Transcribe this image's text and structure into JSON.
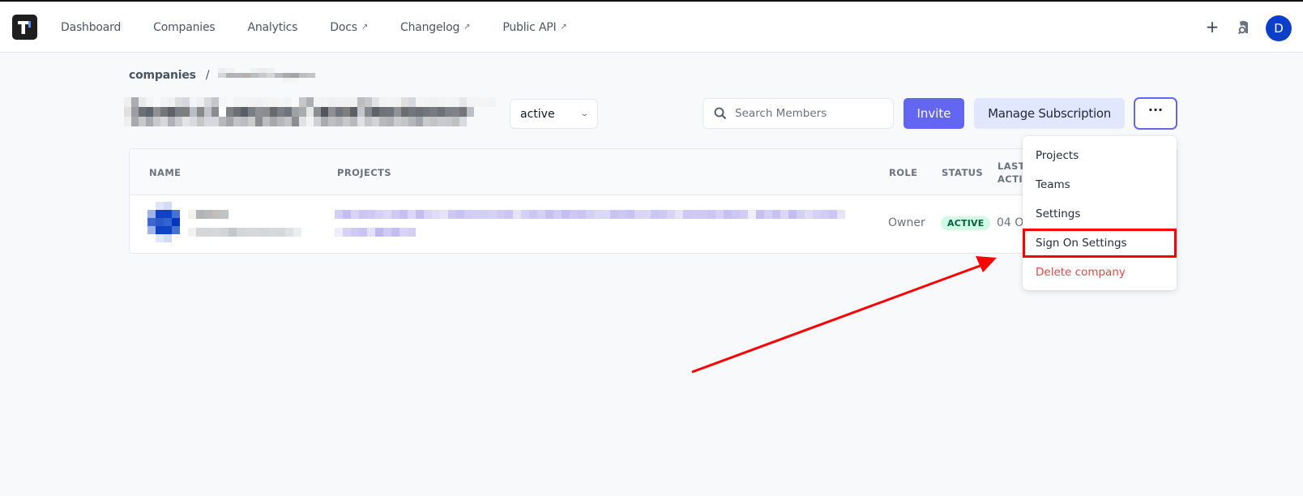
{
  "topbar": {
    "logo_icon": "brand-logo",
    "nav": [
      {
        "label": "Dashboard",
        "external": false
      },
      {
        "label": "Companies",
        "external": false
      },
      {
        "label": "Analytics",
        "external": false
      },
      {
        "label": "Docs",
        "external": true
      },
      {
        "label": "Changelog",
        "external": true
      },
      {
        "label": "Public API",
        "external": true
      }
    ],
    "external_icon": "↗",
    "add_icon": "+",
    "avatar_initial": "D",
    "avatar_color": "#0b3fc8"
  },
  "breadcrumb": {
    "root": "companies",
    "separator": "/",
    "current": "[redacted]"
  },
  "company": {
    "name": "[redacted]",
    "status_select": {
      "value": "active"
    }
  },
  "toolbar": {
    "search_placeholder": "Search Members",
    "search_value": "",
    "invite_label": "Invite",
    "manage_subscription_label": "Manage Subscription",
    "more_label": "···",
    "accent_color": "#6366f1"
  },
  "table": {
    "headers": {
      "name": "NAME",
      "projects": "PROJECTS",
      "role": "ROLE",
      "status": "STATUS",
      "last_active_line1": "LAST",
      "last_active_line2": "ACTIVE"
    },
    "rows": [
      {
        "name": "[redacted]",
        "email": "[redacted]",
        "projects": "[redacted]",
        "role": "Owner",
        "status": "ACTIVE",
        "last_active": "04 O"
      }
    ]
  },
  "more_menu": {
    "items": [
      {
        "label": "Projects",
        "danger": false,
        "highlighted": false
      },
      {
        "label": "Teams",
        "danger": false,
        "highlighted": false
      },
      {
        "label": "Settings",
        "danger": false,
        "highlighted": false
      },
      {
        "label": "Sign On Settings",
        "danger": false,
        "highlighted": true
      },
      {
        "label": "Delete company",
        "danger": true,
        "highlighted": false
      }
    ]
  },
  "annotation": {
    "arrow_color": "#ff0000",
    "highlight_color": "#ff0000",
    "target": "Sign On Settings"
  }
}
